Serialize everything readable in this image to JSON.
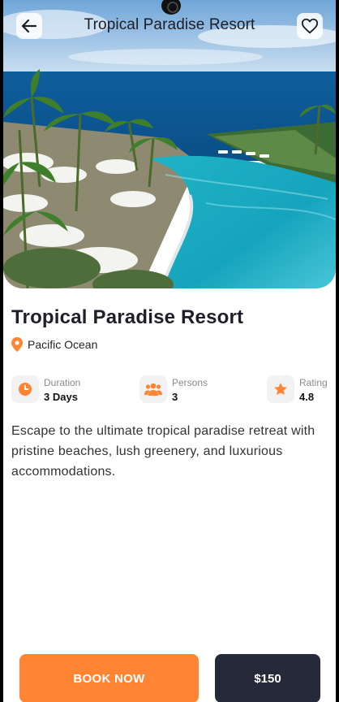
{
  "header": {
    "title": "Tropical Paradise Resort",
    "back_icon": "arrow-left-icon",
    "favorite_icon": "heart-outline-icon"
  },
  "hero_image": {
    "subject": "infinity pool resort by the ocean with palm trees and white umbrellas"
  },
  "resort": {
    "name": "Tropical Paradise Resort",
    "location": "Pacific Ocean",
    "location_icon": "location-pin-icon",
    "description": "Escape to the ultimate tropical paradise retreat with pristine beaches, lush greenery, and luxurious accommodations."
  },
  "stats": [
    {
      "label": "Duration",
      "value": "3 Days",
      "icon": "clock-icon"
    },
    {
      "label": "Persons",
      "value": "3",
      "icon": "people-icon"
    },
    {
      "label": "Rating",
      "value": "4.8",
      "icon": "star-icon"
    }
  ],
  "actions": {
    "book_label": "BOOK NOW",
    "price_label": "$150"
  },
  "colors": {
    "accent": "#ff8434",
    "dark": "#262937",
    "text": "#1f1f2b"
  }
}
